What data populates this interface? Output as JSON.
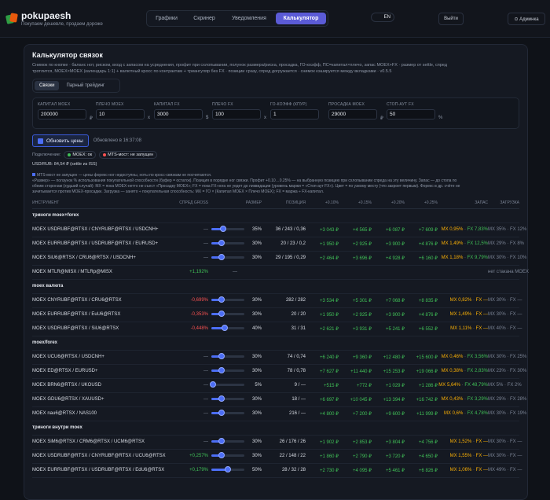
{
  "header": {
    "brand": "pokupaesh",
    "tagline": "Покупаем дешевле, продаем дороже",
    "tabs": [
      "Графики",
      "Скринер",
      "Уведомления",
      "Калькулятор"
    ],
    "active_tab": 3,
    "lang": "EN",
    "exit": "Выйти",
    "admin": "⊙ Админка"
  },
  "page": {
    "title": "Калькулятор связок",
    "desc1": "Снимок по кнопке · баланс нот, риском, вход с запасом на усреднения, профит при схлопывании, полунок размера/риска, просадка, ГО-коэфф, ПС=капитал×плечо, запас MOEX+FX · размер от settle, спред",
    "desc2": "тротлится, MOEX×MOEX (календарь 1:1) + валютный кросс по контрактам + триангуляр без FX · позиции сразу, спред догружается · снимок кэшируется между вкладками · v0.5.5"
  },
  "subtabs": [
    "Связки",
    "Парный трейдинг"
  ],
  "fields": [
    {
      "label": "КАПИТАЛ MOEX",
      "value": "200000",
      "unit": "₽"
    },
    {
      "label": "ПЛЕЧО MOEX",
      "value": "10",
      "unit": "x"
    },
    {
      "label": "КАПИТАЛ FX",
      "value": "3000",
      "unit": "$"
    },
    {
      "label": "ПЛЕЧО FX",
      "value": "100",
      "unit": "x"
    },
    {
      "label": "ГО-КОЭФФ (КПУР)",
      "value": "1",
      "unit": ""
    },
    {
      "label": "ПРОСАДКА MOEX",
      "value": "29000",
      "unit": "₽"
    },
    {
      "label": "СТОП-АУТ FX",
      "value": "50",
      "unit": "%"
    }
  ],
  "refresh": {
    "label": "Обновить цены",
    "updated": "Обновлено в 16:37:08"
  },
  "conn": {
    "label": "Подключение:",
    "moex": "MOEX: ок",
    "mts": "MTS-мост: не запущен"
  },
  "usd": "USD/RUB: 84,54 ₽ (settle из ISS)",
  "notes": {
    "n1": "MTS-мост не запущен — цены форекс-ног недоступны, ноты по кросс-связкам не посчитаются.",
    "n2": "«Размер» — ползунок % использования покупательной способности (буфер = остаток). Позиция в порядке ног связки. Профит +0.10…0.25% — на выбранную позицию при схлопывании спреда на эту величину. Запас — до стопа по",
    "n3": "обеим сторонам (худший случай): MX = пока MOEX-нетто не съест «Просадку MOEX»; FX = пока FX-нога не уедет до ликвидации (уровень маржи = «Стоп-аут FX»). Цвет = по узкому месту (что закроет первым). Форекс в др. счёте не",
    "n4": "зачитывается против MOEX-просадки. Загрузка — занято ÷ покупательная способность: MX = ГО × (Капитал MOEX × Плечо MOEX); FX = маржа ÷ FX-капитал."
  },
  "columns": [
    "ИНСТРУМЕНТ",
    "СПРЕД GROSS",
    "РАЗМЕР",
    "ПОЗИЦИЯ",
    "+0.10%",
    "+0.15%",
    "+0.20%",
    "+0.25%",
    "ЗАПАС",
    "ЗАГРУЗКА"
  ],
  "groups": [
    {
      "name": "триноги moex+forex",
      "rows": [
        {
          "inst": "MOEX USDRUBF@RTSX / CNYRUBF@RTSX / USDCNH+",
          "spread": "—",
          "size": 35,
          "size_label": "35%",
          "pos": "36 / 243 / 0,36",
          "p10": "+3 043 ₽",
          "p15": "+4 565 ₽",
          "p20": "+6 087 ₽",
          "p25": "+7 609 ₽",
          "mx": "MX 0,95%",
          "fx": "FX 7,83%",
          "load": "MX 35% · FX 12%"
        },
        {
          "inst": "MOEX EURRUBF@RTSX / USDRUBF@RTSX / EURUSD+",
          "spread": "—",
          "size": 30,
          "size_label": "30%",
          "pos": "20 / 23 / 0,2",
          "p10": "+1 950 ₽",
          "p15": "+2 925 ₽",
          "p20": "+3 900 ₽",
          "p25": "+4 876 ₽",
          "mx": "MX 1,49%",
          "fx": "FX 12,5%",
          "load": "MX 29% · FX 8%"
        },
        {
          "inst": "MOEX SiU6@RTSX / CRU6@RTSX / USDCNH+",
          "spread": "—",
          "size": 30,
          "size_label": "30%",
          "pos": "29 / 195 / 0,29",
          "p10": "+2 464 ₽",
          "p15": "+3 696 ₽",
          "p20": "+4 928 ₽",
          "p25": "+6 160 ₽",
          "mx": "MX 1,18%",
          "fx": "FX 9,79%",
          "load": "MX 30% · FX 10%"
        },
        {
          "inst": "MOEX MTLR@MISX / MTLRp@MISX",
          "spread": "+1,192%",
          "size": null,
          "size_label": "—",
          "pos": "",
          "p10": "",
          "p15": "",
          "p20": "",
          "p25": "",
          "mx": "",
          "fx": "",
          "load": "нет стакана MOEX"
        }
      ]
    },
    {
      "name": "moex валюта",
      "rows": [
        {
          "inst": "MOEX CNYRUBF@RTSX / CRU6@RTSX",
          "spread": "-0,699%",
          "size": 30,
          "size_label": "30%",
          "pos": "282 / 282",
          "p10": "+3 534 ₽",
          "p15": "+5 301 ₽",
          "p20": "+7 068 ₽",
          "p25": "+8 835 ₽",
          "mx": "MX 0,82%",
          "fx": "FX —",
          "load": "MX 30% · FX —"
        },
        {
          "inst": "MOEX EURRUBF@RTSX / EuU6@RTSX",
          "spread": "-0,353%",
          "size": 30,
          "size_label": "30%",
          "pos": "20 / 20",
          "p10": "+1 950 ₽",
          "p15": "+2 925 ₽",
          "p20": "+3 900 ₽",
          "p25": "+4 876 ₽",
          "mx": "MX 1,49%",
          "fx": "FX —",
          "load": "MX 30% · FX —"
        },
        {
          "inst": "MOEX USDRUBF@RTSX / SiU6@RTSX",
          "spread": "-0,448%",
          "size": 40,
          "size_label": "40%",
          "pos": "31 / 31",
          "p10": "+2 621 ₽",
          "p15": "+3 931 ₽",
          "p20": "+5 241 ₽",
          "p25": "+6 552 ₽",
          "mx": "MX 1,11%",
          "fx": "FX —",
          "load": "MX 40% · FX —"
        }
      ]
    },
    {
      "name": "moex/forex",
      "rows": [
        {
          "inst": "MOEX UCU6@RTSX / USDCNH+",
          "spread": "—",
          "size": 30,
          "size_label": "30%",
          "pos": "74 / 0,74",
          "p10": "+6 240 ₽",
          "p15": "+9 360 ₽",
          "p20": "+12 480 ₽",
          "p25": "+15 600 ₽",
          "mx": "MX 0,46%",
          "fx": "FX 3,56%",
          "load": "MX 30% · FX 25%"
        },
        {
          "inst": "MOEX ED@RTSX / EURUSD+",
          "spread": "—",
          "size": 30,
          "size_label": "30%",
          "pos": "78 / 0,78",
          "p10": "+7 627 ₽",
          "p15": "+11 440 ₽",
          "p20": "+15 253 ₽",
          "p25": "+19 066 ₽",
          "mx": "MX 0,38%",
          "fx": "FX 2,83%",
          "load": "MX 23% · FX 30%"
        },
        {
          "inst": "MOEX BRN6@RTSX / UKOUSD",
          "spread": "—",
          "size": 5,
          "size_label": "5%",
          "pos": "9 / —",
          "p10": "+515 ₽",
          "p15": "+772 ₽",
          "p20": "+1 029 ₽",
          "p25": "+1 286 ₽",
          "mx": "MX 5,64%",
          "fx": "FX 48,79%",
          "load": "MX 5% · FX 2%"
        },
        {
          "inst": "MOEX GDU6@RTSX / XAUUSD+",
          "spread": "—",
          "size": 30,
          "size_label": "30%",
          "pos": "18 / —",
          "p10": "+6 697 ₽",
          "p15": "+10 045 ₽",
          "p20": "+13 394 ₽",
          "p25": "+16 742 ₽",
          "mx": "MX 0,43%",
          "fx": "FX 3,29%",
          "load": "MX 29% · FX 28%"
        },
        {
          "inst": "MOEX nau6@RTSX / NAS100",
          "spread": "—",
          "size": 30,
          "size_label": "30%",
          "pos": "216 / —",
          "p10": "+4 800 ₽",
          "p15": "+7 200 ₽",
          "p20": "+9 600 ₽",
          "p25": "+11 999 ₽",
          "mx": "MX 0,6%",
          "fx": "FX 4,78%",
          "load": "MX 30% · FX 19%"
        }
      ]
    },
    {
      "name": "триноги внутри moex",
      "rows": [
        {
          "inst": "MOEX SiM6@RTSX / CRM6@RTSX / UCM6@RTSX",
          "spread": "—",
          "size": 30,
          "size_label": "30%",
          "pos": "26 / 176 / 26",
          "p10": "+1 902 ₽",
          "p15": "+2 853 ₽",
          "p20": "+3 804 ₽",
          "p25": "+4 756 ₽",
          "mx": "MX 1,52%",
          "fx": "FX —",
          "load": "MX 30% · FX —"
        },
        {
          "inst": "MOEX USDRUBF@RTSX / CNYRUBF@RTSX / UCU6@RTSX",
          "spread": "+0,257%",
          "size": 30,
          "size_label": "30%",
          "pos": "22 / 148 / 22",
          "p10": "+1 860 ₽",
          "p15": "+2 790 ₽",
          "p20": "+3 720 ₽",
          "p25": "+4 650 ₽",
          "mx": "MX 1,55%",
          "fx": "FX —",
          "load": "MX 30% · FX —"
        },
        {
          "inst": "MOEX EURRUBF@RTSX / USDRUBF@RTSX / EdU6@RTSX",
          "spread": "+0,179%",
          "size": 50,
          "size_label": "50%",
          "pos": "28 / 32 / 28",
          "p10": "+2 730 ₽",
          "p15": "+4 095 ₽",
          "p20": "+5 461 ₽",
          "p25": "+6 826 ₽",
          "mx": "MX 1,06%",
          "fx": "FX —",
          "load": "MX 49% · FX —"
        }
      ]
    }
  ]
}
